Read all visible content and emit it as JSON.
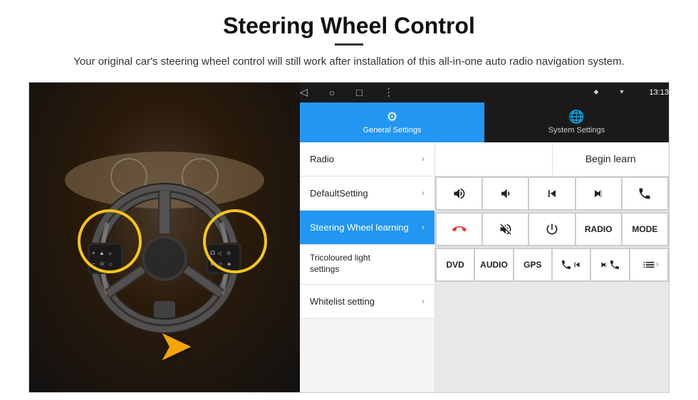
{
  "header": {
    "title": "Steering Wheel Control",
    "subtitle": "Your original car's steering wheel control will still work after installation of this all-in-one auto radio navigation system."
  },
  "android": {
    "status_bar": {
      "time": "13:13",
      "icons": [
        "location",
        "wifi",
        "signal"
      ]
    },
    "nav": {
      "back": "◁",
      "home": "○",
      "recent": "□",
      "menu": "⋮"
    },
    "tabs": [
      {
        "label": "General Settings",
        "icon": "⚙",
        "active": true
      },
      {
        "label": "System Settings",
        "icon": "🌐",
        "active": false
      }
    ],
    "menu": [
      {
        "label": "Radio",
        "active": false
      },
      {
        "label": "DefaultSetting",
        "active": false
      },
      {
        "label": "Steering Wheel learning",
        "active": true
      },
      {
        "label": "Tricoloured light settings",
        "active": false
      },
      {
        "label": "Whitelist setting",
        "active": false
      }
    ],
    "begin_learn": "Begin learn",
    "controls": {
      "row1": [
        "vol+",
        "vol-",
        "prev",
        "next",
        "phone"
      ],
      "row2": [
        "hangup",
        "mute",
        "power",
        "RADIO",
        "MODE"
      ],
      "row3": [
        "DVD",
        "AUDIO",
        "GPS",
        "phone-prev",
        "phone-next"
      ]
    }
  }
}
